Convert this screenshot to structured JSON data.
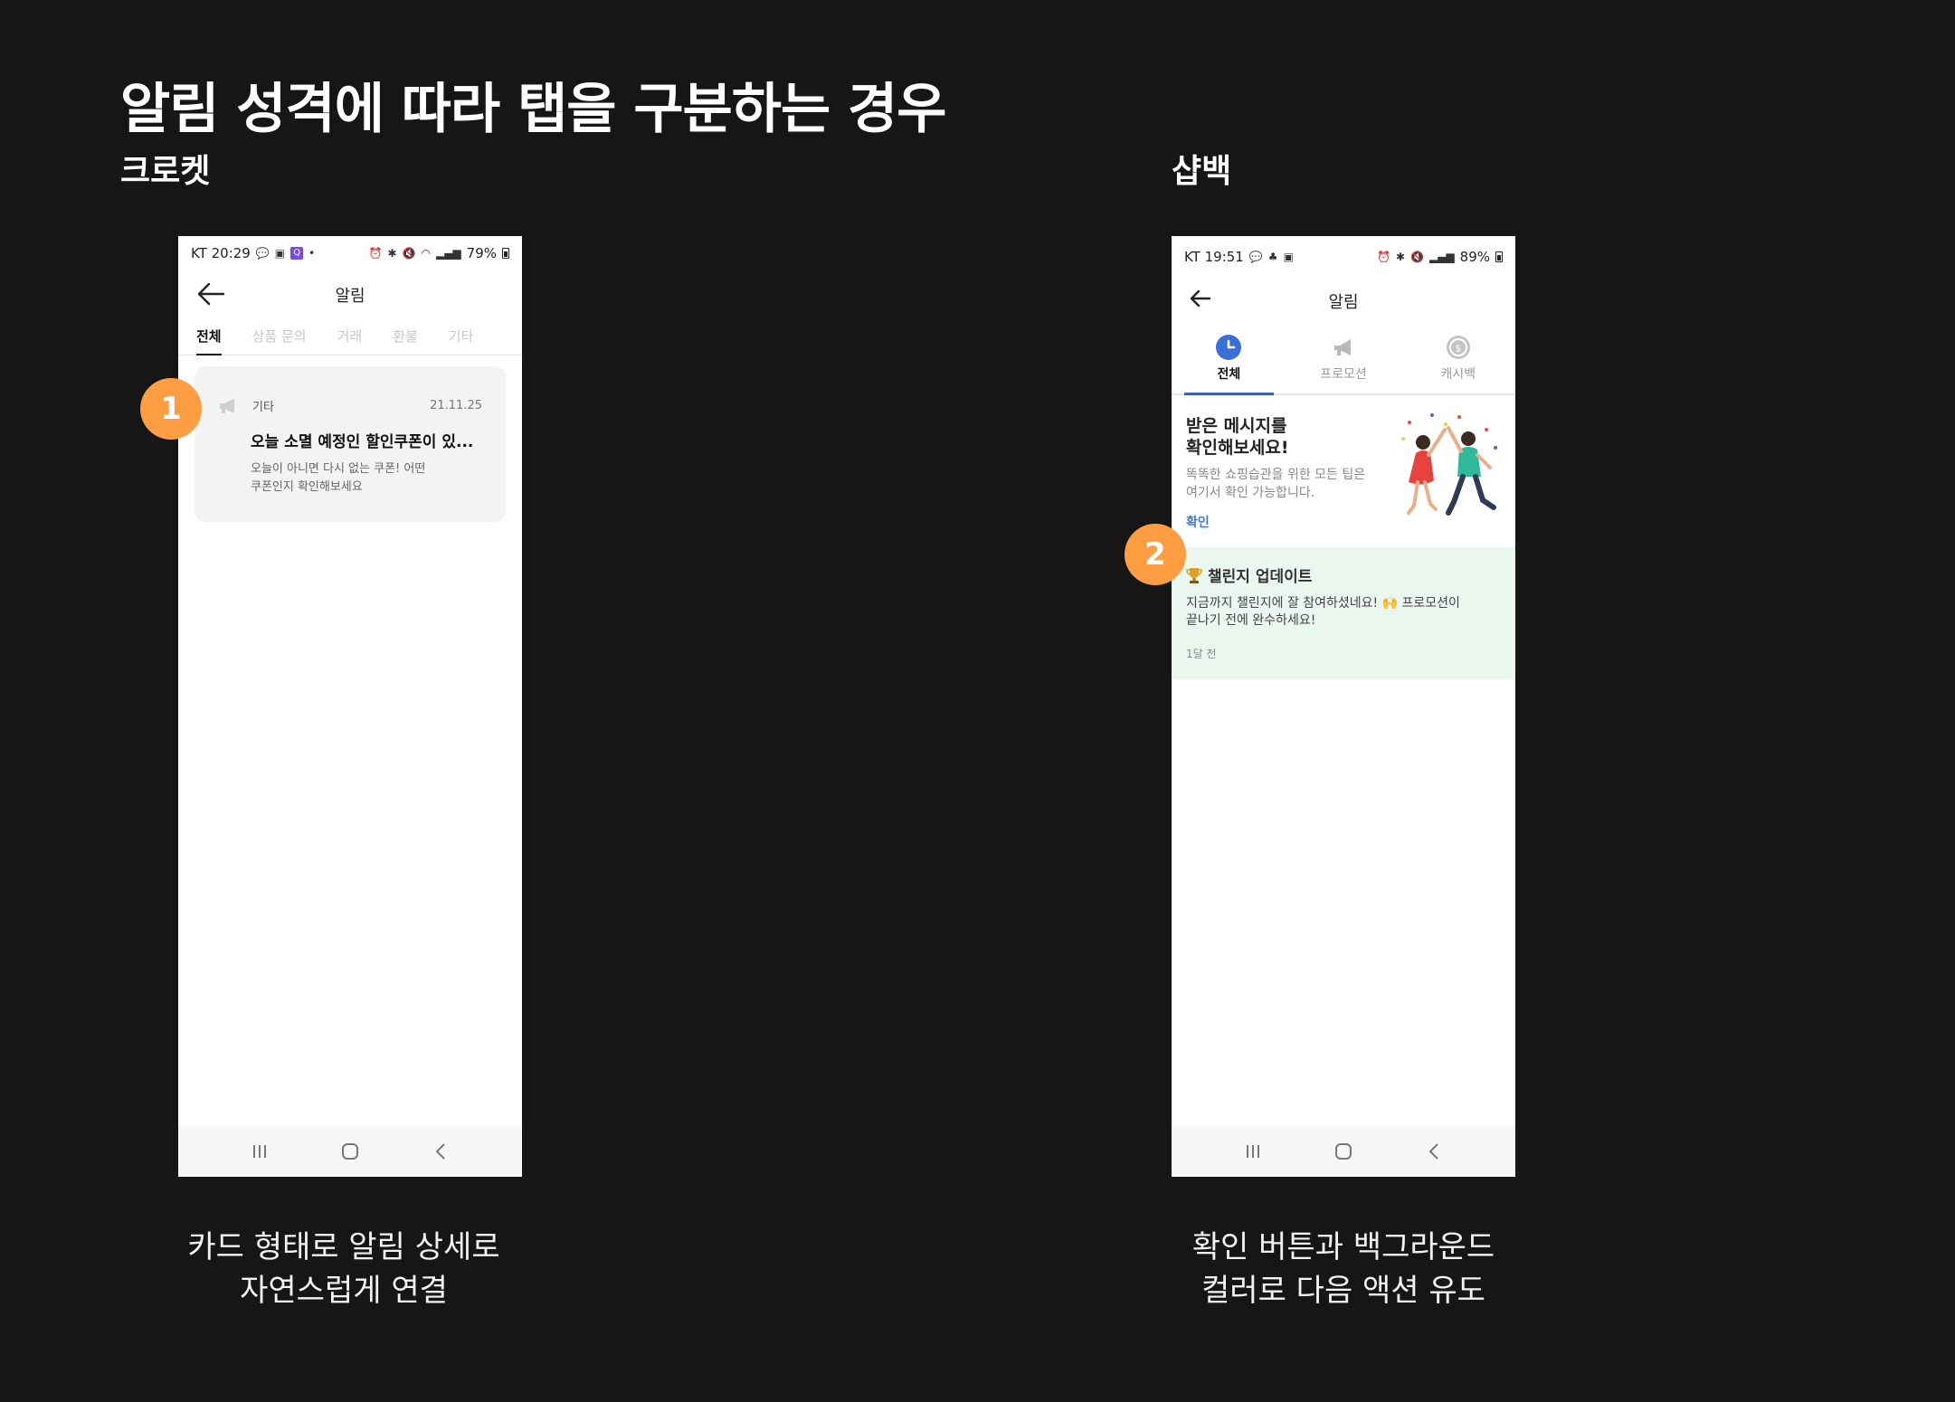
{
  "page": {
    "title": "알림 성격에 따라 탭을 구분하는 경우"
  },
  "left": {
    "label": "크로켓",
    "marker": "1",
    "caption": [
      "카드 형태로 알림 상세로",
      "자연스럽게 연결"
    ],
    "phone": {
      "status": {
        "carrier_time": "KT 20:29",
        "battery": "79%",
        "badge": "Q"
      },
      "title": "알림",
      "tabs": [
        "전체",
        "상품 문의",
        "거래",
        "환불",
        "기타"
      ],
      "active_tab": 0,
      "card": {
        "category": "기타",
        "date": "21.11.25",
        "headline": "오늘 소멸 예정인 할인쿠폰이 있...",
        "body_line1": "오늘이 아니면 다시 없는 쿠폰! 어떤",
        "body_line2": "쿠폰인지 확인해보세요"
      }
    }
  },
  "right": {
    "label": "샵백",
    "marker": "2",
    "caption": [
      "확인 버튼과 백그라운드",
      "컬러로 다음 액션 유도"
    ],
    "phone": {
      "status": {
        "carrier_time": "KT 19:51",
        "battery": "89%"
      },
      "title": "알림",
      "tabs": [
        {
          "label": "전체",
          "icon": "clock-icon"
        },
        {
          "label": "프로모션",
          "icon": "megaphone-icon"
        },
        {
          "label": "캐시백",
          "icon": "coin-icon"
        }
      ],
      "active_tab": 0,
      "promo": {
        "title_line1": "받은 메시지를",
        "title_line2": "확인해보세요!",
        "body_line1": "똑똑한 쇼핑습관을 위한 모든 팁은",
        "body_line2": "여기서 확인 가능합니다.",
        "link": "확인"
      },
      "challenge": {
        "title": "챌린지 업데이트",
        "body_line1": "지금까지 챌린지에 잘 참여하셨네요! 🙌 프로모션이",
        "body_line2": "끝나기 전에 완수하세요!",
        "time": "1달 전"
      }
    }
  },
  "colors": {
    "background": "#161616",
    "marker": "#ff9d42",
    "link_blue": "#3b78d8",
    "challenge_bg": "#eaf7ef",
    "tab_indicator": "#3a5fb8"
  }
}
